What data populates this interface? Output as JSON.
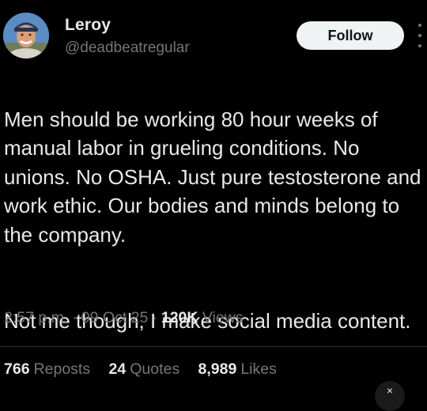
{
  "author": {
    "display_name": "Leroy",
    "handle": "@deadbeatregular",
    "avatar_icon": "profile-photo"
  },
  "follow_button": {
    "label": "Follow"
  },
  "more_options": {
    "icon": "vertical-dots-icon"
  },
  "tweet": {
    "paragraphs": [
      "Men should be working 80 hour weeks of manual labor in grueling conditions. No unions. No OSHA. Just pure testosterone and work ethic. Our bodies and minds belong to the company.",
      "Not me though, I make social media content."
    ]
  },
  "meta": {
    "time": "2:57 p.m.",
    "separator": "·",
    "date": "09 Oct 25",
    "views_count": "120K",
    "views_label": "Views"
  },
  "stats": {
    "reposts_count": "766",
    "reposts_label": "Reposts",
    "quotes_count": "24",
    "quotes_label": "Quotes",
    "likes_count": "8,989",
    "likes_label": "Likes"
  },
  "corner_button": {
    "glyph": "×"
  },
  "colors": {
    "background": "#000000",
    "primary_text": "#e7e9ea",
    "secondary_text": "#71767b",
    "follow_bg": "#eff3f4",
    "follow_text": "#0f1419",
    "divider": "#2f3336"
  }
}
